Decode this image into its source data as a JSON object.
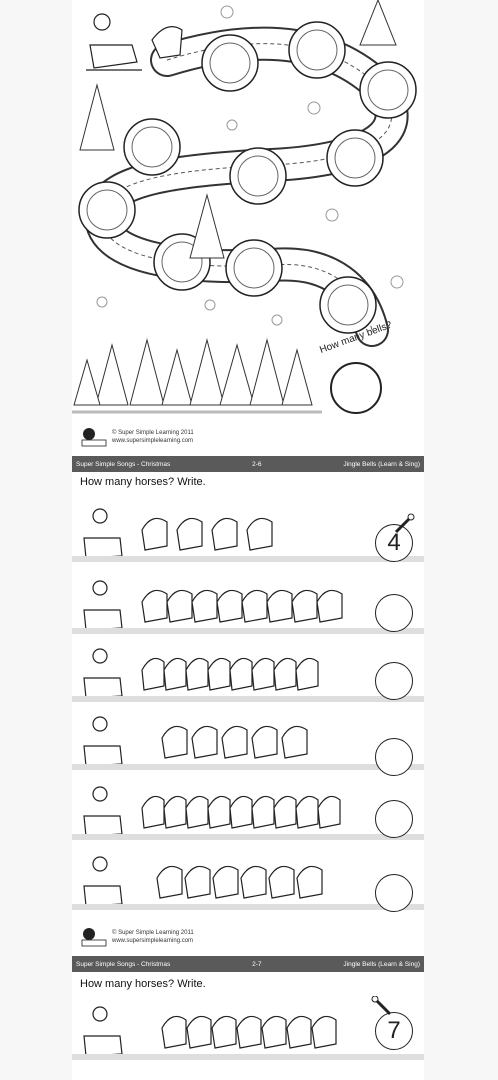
{
  "page1": {
    "bell_question": "How many bells?",
    "copyright_line1": "© Super Simple Learning 2011",
    "copyright_line2": "www.supersimplelearning.com",
    "logo_text": "Super Simple Learning"
  },
  "footer1": {
    "left": "Super Simple Songs - Christmas",
    "center": "2-6",
    "right": "Jingle Bells (Learn & Sing)"
  },
  "page2": {
    "heading": "How many horses? Write.",
    "rows": [
      {
        "answer": "4"
      },
      {
        "answer": ""
      },
      {
        "answer": ""
      },
      {
        "answer": ""
      },
      {
        "answer": ""
      },
      {
        "answer": ""
      }
    ],
    "copyright_line1": "© Super Simple Learning 2011",
    "copyright_line2": "www.supersimplelearning.com"
  },
  "footer2": {
    "left": "Super Simple Songs - Christmas",
    "center": "2-7",
    "right": "Jingle Bells (Learn & Sing)"
  },
  "page3": {
    "heading": "How many horses? Write.",
    "rows": [
      {
        "answer": "7"
      }
    ]
  }
}
